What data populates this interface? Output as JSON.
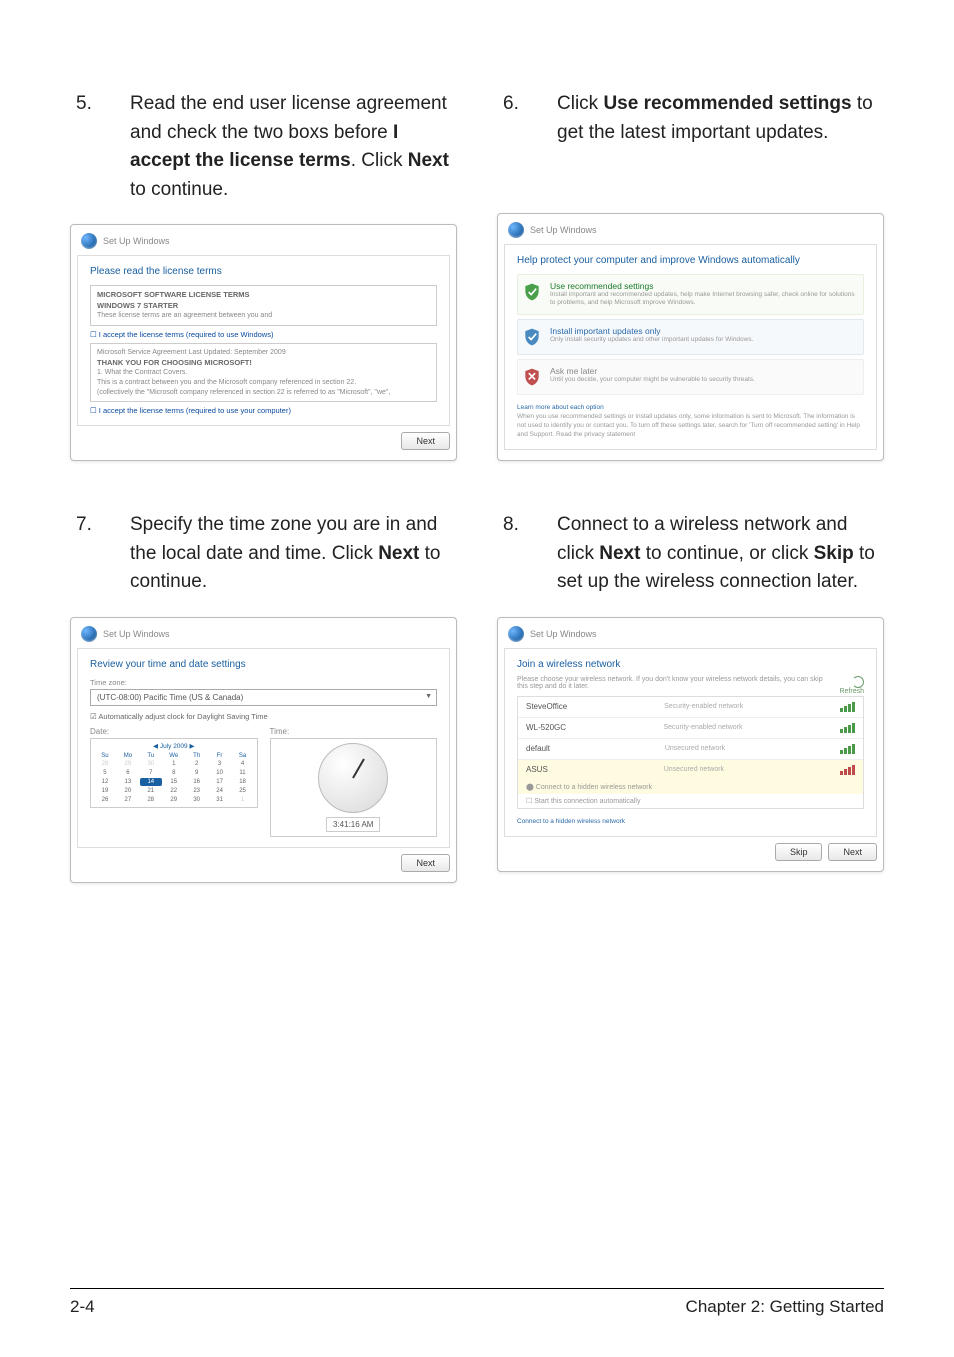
{
  "steps": {
    "s5": {
      "num": "5.",
      "pre": "Read the end user license agreement and check the two boxs before ",
      "b1": "I accept the license terms",
      "mid": ". Click ",
      "b2": "Next",
      "post": " to continue."
    },
    "s6": {
      "num": "6.",
      "pre": "Click ",
      "b1": "Use recommended settings",
      "mid": " to get the latest important updates.",
      "b2": "",
      "post": ""
    },
    "s7": {
      "num": "7.",
      "pre": "Specify the time zone you are in and the local date and time. Click ",
      "b1": "Next",
      "mid": " to continue.",
      "b2": "",
      "post": ""
    },
    "s8": {
      "num": "8.",
      "pre": "Connect to a wireless network and click ",
      "b1": "Next",
      "mid": " to continue, or click ",
      "b2": "Skip",
      "post": " to set up the wireless connection later."
    }
  },
  "shot5": {
    "win": "Set Up Windows",
    "heading": "Please read the license terms",
    "b1t1": "MICROSOFT SOFTWARE LICENSE TERMS",
    "b1t2": "WINDOWS 7 STARTER",
    "b1t3": "These license terms are an agreement between you and",
    "chk1": "☐ I accept the license terms (required to use Windows)",
    "b2t1": "Microsoft Service Agreement Last Updated: September 2009",
    "b2t2": "THANK YOU FOR CHOOSING MICROSOFT!",
    "b2t3": "1. What the Contract Covers.",
    "b2t4": "This is a contract between you and the Microsoft company referenced in section 22.",
    "b2t5": "(collectively the \"Microsoft company referenced in section 22 is referred to as \"Microsoft\", \"we\",",
    "chk2": "☐ I accept the license terms (required to use your computer)",
    "next": "Next"
  },
  "shot6": {
    "win": "Set Up Windows",
    "heading": "Help protect your computer and improve Windows automatically",
    "o1t": "Use recommended settings",
    "o1s": "Install important and recommended updates, help make Internet browsing safer, check online for solutions to problems, and help Microsoft improve Windows.",
    "o2t": "Install important updates only",
    "o2s": "Only install security updates and other important updates for Windows.",
    "o3t": "Ask me later",
    "o3s": "Until you decide, your computer might be vulnerable to security threats.",
    "lk": "Learn more about each option",
    "fine": "When you use recommended settings or install updates only, some information is sent to Microsoft. The information is not used to identify you or contact you. To turn off these settings later, search for 'Turn off recommended setting' in Help and Support. Read the privacy statement"
  },
  "shot7": {
    "win": "Set Up Windows",
    "heading": "Review your time and date settings",
    "tzlabel": "Time zone:",
    "tz": "(UTC-08:00) Pacific Time (US & Canada)",
    "dst": "☑ Automatically adjust clock for Daylight Saving Time",
    "dateLabel": "Date:",
    "timeLabel": "Time:",
    "month": "July 2009",
    "dows": [
      "Su",
      "Mo",
      "Tu",
      "We",
      "Th",
      "Fr",
      "Sa"
    ],
    "days": [
      "28",
      "29",
      "30",
      "1",
      "2",
      "3",
      "4",
      "5",
      "6",
      "7",
      "8",
      "9",
      "10",
      "11",
      "12",
      "13",
      "14",
      "15",
      "16",
      "17",
      "18",
      "19",
      "20",
      "21",
      "22",
      "23",
      "24",
      "25",
      "26",
      "27",
      "28",
      "29",
      "30",
      "31",
      "1"
    ],
    "time": "3:41:16 AM",
    "next": "Next"
  },
  "shot8": {
    "win": "Set Up Windows",
    "heading": "Join a wireless network",
    "sub": "Please choose your wireless network. If you don't know your wireless network details, you can skip this step and do it later.",
    "refresh": "Refresh",
    "rows": [
      {
        "name": "SteveOffice",
        "sec": "Security-enabled network",
        "bars": "g"
      },
      {
        "name": "WL-520GC",
        "sec": "Security-enabled network",
        "bars": "g"
      },
      {
        "name": "default",
        "sec": "Unsecured network",
        "bars": "g"
      },
      {
        "name": "ASUS",
        "sec": "Unsecured network",
        "bars": "r"
      }
    ],
    "seltext": "Connect to a hidden wireless network",
    "conn": "☐ Start this connection automatically",
    "lk": "Connect to a hidden wireless network",
    "skip": "Skip",
    "next": "Next"
  },
  "footer": {
    "left": "2-4",
    "right": "Chapter 2: Getting Started"
  }
}
